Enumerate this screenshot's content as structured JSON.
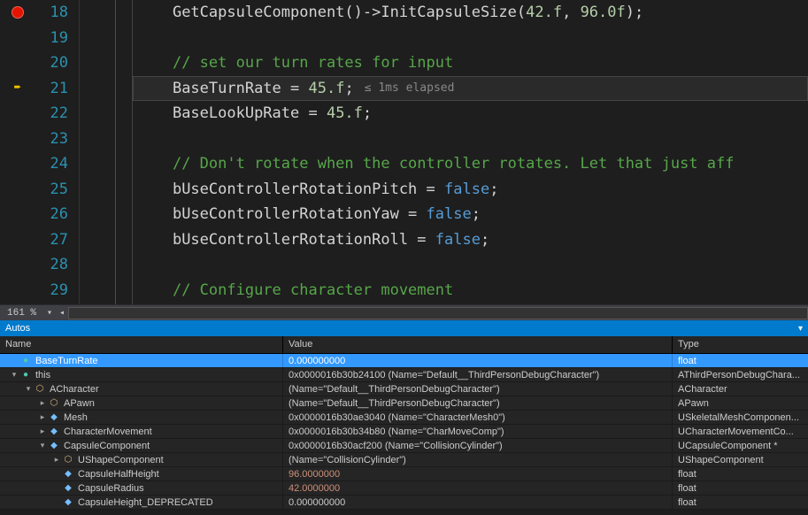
{
  "zoom": "161 %",
  "elapsed_hint": "≤ 1ms elapsed",
  "lines": [
    {
      "no": 18,
      "tokens": [
        {
          "t": "    ",
          "c": ""
        },
        {
          "t": "GetCapsuleComponent()->InitCapsuleSize(",
          "c": "c-fn"
        },
        {
          "t": "42.f",
          "c": "c-num"
        },
        {
          "t": ", ",
          "c": "c-fn"
        },
        {
          "t": "96.0f",
          "c": "c-num"
        },
        {
          "t": ");",
          "c": "c-fn"
        }
      ],
      "breakpoint": true
    },
    {
      "no": 19,
      "tokens": []
    },
    {
      "no": 20,
      "tokens": [
        {
          "t": "    ",
          "c": ""
        },
        {
          "t": "// set our turn rates for input",
          "c": "c-comment"
        }
      ]
    },
    {
      "no": 21,
      "tokens": [
        {
          "t": "    ",
          "c": ""
        },
        {
          "t": "BaseTurnRate = ",
          "c": "c-fn"
        },
        {
          "t": "45.f",
          "c": "c-num"
        },
        {
          "t": ";",
          "c": "c-fn"
        }
      ],
      "current": true,
      "show_elapsed": true
    },
    {
      "no": 22,
      "tokens": [
        {
          "t": "    ",
          "c": ""
        },
        {
          "t": "BaseLookUpRate = ",
          "c": "c-fn"
        },
        {
          "t": "45.f",
          "c": "c-num"
        },
        {
          "t": ";",
          "c": "c-fn"
        }
      ]
    },
    {
      "no": 23,
      "tokens": []
    },
    {
      "no": 24,
      "tokens": [
        {
          "t": "    ",
          "c": ""
        },
        {
          "t": "// Don't rotate when the controller rotates. Let that just aff",
          "c": "c-comment"
        }
      ]
    },
    {
      "no": 25,
      "tokens": [
        {
          "t": "    ",
          "c": ""
        },
        {
          "t": "bUseControllerRotationPitch = ",
          "c": "c-fn"
        },
        {
          "t": "false",
          "c": "c-kw"
        },
        {
          "t": ";",
          "c": "c-fn"
        }
      ]
    },
    {
      "no": 26,
      "tokens": [
        {
          "t": "    ",
          "c": ""
        },
        {
          "t": "bUseControllerRotationYaw = ",
          "c": "c-fn"
        },
        {
          "t": "false",
          "c": "c-kw"
        },
        {
          "t": ";",
          "c": "c-fn"
        }
      ]
    },
    {
      "no": 27,
      "tokens": [
        {
          "t": "    ",
          "c": ""
        },
        {
          "t": "bUseControllerRotationRoll = ",
          "c": "c-fn"
        },
        {
          "t": "false",
          "c": "c-kw"
        },
        {
          "t": ";",
          "c": "c-fn"
        }
      ]
    },
    {
      "no": 28,
      "tokens": []
    },
    {
      "no": 29,
      "tokens": [
        {
          "t": "    ",
          "c": ""
        },
        {
          "t": "// Configure character movement",
          "c": "c-comment"
        }
      ]
    }
  ],
  "autos": {
    "title": "Autos",
    "headers": {
      "name": "Name",
      "value": "Value",
      "type": "Type"
    },
    "rows": [
      {
        "depth": 0,
        "exp": "",
        "icon": "icon-var",
        "name": "BaseTurnRate",
        "value": "0.000000000",
        "type": "float",
        "selected": true
      },
      {
        "depth": 0,
        "exp": "▾",
        "icon": "icon-var",
        "name": "this",
        "value": "0x0000016b30b24100 (Name=\"Default__ThirdPersonDebugCharacter\")",
        "type": "AThirdPersonDebugChara..."
      },
      {
        "depth": 1,
        "exp": "▾",
        "icon": "icon-class",
        "name": "ACharacter",
        "value": "(Name=\"Default__ThirdPersonDebugCharacter\")",
        "type": "ACharacter"
      },
      {
        "depth": 2,
        "exp": "▸",
        "icon": "icon-class",
        "name": "APawn",
        "value": "(Name=\"Default__ThirdPersonDebugCharacter\")",
        "type": "APawn"
      },
      {
        "depth": 2,
        "exp": "▸",
        "icon": "icon-field",
        "name": "Mesh",
        "value": "0x0000016b30ae3040 (Name=\"CharacterMesh0\")",
        "type": "USkeletalMeshComponen..."
      },
      {
        "depth": 2,
        "exp": "▸",
        "icon": "icon-field",
        "name": "CharacterMovement",
        "value": "0x0000016b30b34b80 (Name=\"CharMoveComp\")",
        "type": "UCharacterMovementCo..."
      },
      {
        "depth": 2,
        "exp": "▾",
        "icon": "icon-field",
        "name": "CapsuleComponent",
        "value": "0x0000016b30acf200 (Name=\"CollisionCylinder\")",
        "type": "UCapsuleComponent *"
      },
      {
        "depth": 3,
        "exp": "▸",
        "icon": "icon-class",
        "name": "UShapeComponent",
        "value": "(Name=\"CollisionCylinder\")",
        "type": "UShapeComponent"
      },
      {
        "depth": 3,
        "exp": "",
        "icon": "icon-field",
        "name": "CapsuleHalfHeight",
        "value": "96.0000000",
        "type": "float",
        "red": true
      },
      {
        "depth": 3,
        "exp": "",
        "icon": "icon-field",
        "name": "CapsuleRadius",
        "value": "42.0000000",
        "type": "float",
        "red": true
      },
      {
        "depth": 3,
        "exp": "",
        "icon": "icon-field",
        "name": "CapsuleHeight_DEPRECATED",
        "value": "0.000000000",
        "type": "float"
      }
    ]
  }
}
